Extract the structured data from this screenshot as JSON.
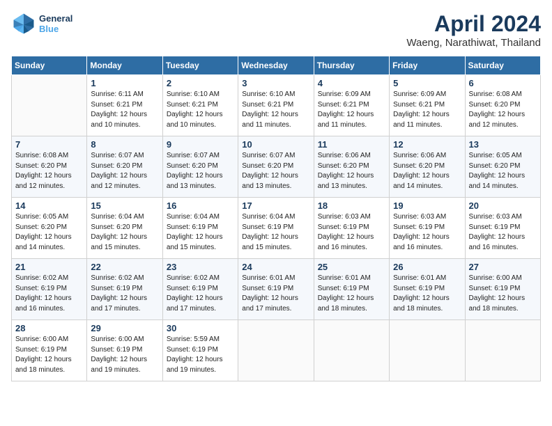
{
  "header": {
    "logo_line1": "General",
    "logo_line2": "Blue",
    "month_title": "April 2024",
    "subtitle": "Waeng, Narathiwat, Thailand"
  },
  "weekdays": [
    "Sunday",
    "Monday",
    "Tuesday",
    "Wednesday",
    "Thursday",
    "Friday",
    "Saturday"
  ],
  "weeks": [
    [
      {
        "num": "",
        "info": ""
      },
      {
        "num": "1",
        "info": "Sunrise: 6:11 AM\nSunset: 6:21 PM\nDaylight: 12 hours\nand 10 minutes."
      },
      {
        "num": "2",
        "info": "Sunrise: 6:10 AM\nSunset: 6:21 PM\nDaylight: 12 hours\nand 10 minutes."
      },
      {
        "num": "3",
        "info": "Sunrise: 6:10 AM\nSunset: 6:21 PM\nDaylight: 12 hours\nand 11 minutes."
      },
      {
        "num": "4",
        "info": "Sunrise: 6:09 AM\nSunset: 6:21 PM\nDaylight: 12 hours\nand 11 minutes."
      },
      {
        "num": "5",
        "info": "Sunrise: 6:09 AM\nSunset: 6:21 PM\nDaylight: 12 hours\nand 11 minutes."
      },
      {
        "num": "6",
        "info": "Sunrise: 6:08 AM\nSunset: 6:20 PM\nDaylight: 12 hours\nand 12 minutes."
      }
    ],
    [
      {
        "num": "7",
        "info": "Sunrise: 6:08 AM\nSunset: 6:20 PM\nDaylight: 12 hours\nand 12 minutes."
      },
      {
        "num": "8",
        "info": "Sunrise: 6:07 AM\nSunset: 6:20 PM\nDaylight: 12 hours\nand 12 minutes."
      },
      {
        "num": "9",
        "info": "Sunrise: 6:07 AM\nSunset: 6:20 PM\nDaylight: 12 hours\nand 13 minutes."
      },
      {
        "num": "10",
        "info": "Sunrise: 6:07 AM\nSunset: 6:20 PM\nDaylight: 12 hours\nand 13 minutes."
      },
      {
        "num": "11",
        "info": "Sunrise: 6:06 AM\nSunset: 6:20 PM\nDaylight: 12 hours\nand 13 minutes."
      },
      {
        "num": "12",
        "info": "Sunrise: 6:06 AM\nSunset: 6:20 PM\nDaylight: 12 hours\nand 14 minutes."
      },
      {
        "num": "13",
        "info": "Sunrise: 6:05 AM\nSunset: 6:20 PM\nDaylight: 12 hours\nand 14 minutes."
      }
    ],
    [
      {
        "num": "14",
        "info": "Sunrise: 6:05 AM\nSunset: 6:20 PM\nDaylight: 12 hours\nand 14 minutes."
      },
      {
        "num": "15",
        "info": "Sunrise: 6:04 AM\nSunset: 6:20 PM\nDaylight: 12 hours\nand 15 minutes."
      },
      {
        "num": "16",
        "info": "Sunrise: 6:04 AM\nSunset: 6:19 PM\nDaylight: 12 hours\nand 15 minutes."
      },
      {
        "num": "17",
        "info": "Sunrise: 6:04 AM\nSunset: 6:19 PM\nDaylight: 12 hours\nand 15 minutes."
      },
      {
        "num": "18",
        "info": "Sunrise: 6:03 AM\nSunset: 6:19 PM\nDaylight: 12 hours\nand 16 minutes."
      },
      {
        "num": "19",
        "info": "Sunrise: 6:03 AM\nSunset: 6:19 PM\nDaylight: 12 hours\nand 16 minutes."
      },
      {
        "num": "20",
        "info": "Sunrise: 6:03 AM\nSunset: 6:19 PM\nDaylight: 12 hours\nand 16 minutes."
      }
    ],
    [
      {
        "num": "21",
        "info": "Sunrise: 6:02 AM\nSunset: 6:19 PM\nDaylight: 12 hours\nand 16 minutes."
      },
      {
        "num": "22",
        "info": "Sunrise: 6:02 AM\nSunset: 6:19 PM\nDaylight: 12 hours\nand 17 minutes."
      },
      {
        "num": "23",
        "info": "Sunrise: 6:02 AM\nSunset: 6:19 PM\nDaylight: 12 hours\nand 17 minutes."
      },
      {
        "num": "24",
        "info": "Sunrise: 6:01 AM\nSunset: 6:19 PM\nDaylight: 12 hours\nand 17 minutes."
      },
      {
        "num": "25",
        "info": "Sunrise: 6:01 AM\nSunset: 6:19 PM\nDaylight: 12 hours\nand 18 minutes."
      },
      {
        "num": "26",
        "info": "Sunrise: 6:01 AM\nSunset: 6:19 PM\nDaylight: 12 hours\nand 18 minutes."
      },
      {
        "num": "27",
        "info": "Sunrise: 6:00 AM\nSunset: 6:19 PM\nDaylight: 12 hours\nand 18 minutes."
      }
    ],
    [
      {
        "num": "28",
        "info": "Sunrise: 6:00 AM\nSunset: 6:19 PM\nDaylight: 12 hours\nand 18 minutes."
      },
      {
        "num": "29",
        "info": "Sunrise: 6:00 AM\nSunset: 6:19 PM\nDaylight: 12 hours\nand 19 minutes."
      },
      {
        "num": "30",
        "info": "Sunrise: 5:59 AM\nSunset: 6:19 PM\nDaylight: 12 hours\nand 19 minutes."
      },
      {
        "num": "",
        "info": ""
      },
      {
        "num": "",
        "info": ""
      },
      {
        "num": "",
        "info": ""
      },
      {
        "num": "",
        "info": ""
      }
    ]
  ]
}
